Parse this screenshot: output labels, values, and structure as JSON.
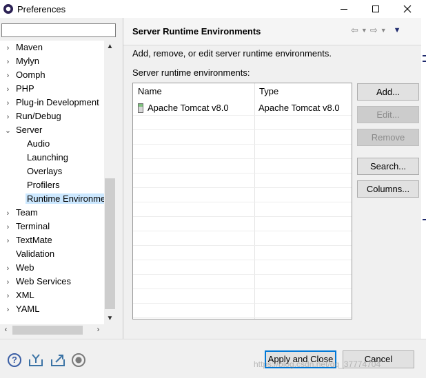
{
  "window": {
    "title": "Preferences"
  },
  "left": {
    "filter_value": "",
    "tree": [
      {
        "label": "Maven",
        "level": 0,
        "expandable": true
      },
      {
        "label": "Mylyn",
        "level": 0,
        "expandable": true
      },
      {
        "label": "Oomph",
        "level": 0,
        "expandable": true
      },
      {
        "label": "PHP",
        "level": 0,
        "expandable": true
      },
      {
        "label": "Plug-in Development",
        "level": 0,
        "expandable": true
      },
      {
        "label": "Run/Debug",
        "level": 0,
        "expandable": true
      },
      {
        "label": "Server",
        "level": 0,
        "expandable": true,
        "expanded": true
      },
      {
        "label": "Audio",
        "level": 1
      },
      {
        "label": "Launching",
        "level": 1
      },
      {
        "label": "Overlays",
        "level": 1
      },
      {
        "label": "Profilers",
        "level": 1
      },
      {
        "label": "Runtime Environme",
        "level": 1,
        "selected": true
      },
      {
        "label": "Team",
        "level": 0,
        "expandable": true
      },
      {
        "label": "Terminal",
        "level": 0,
        "expandable": true
      },
      {
        "label": "TextMate",
        "level": 0,
        "expandable": true
      },
      {
        "label": "Validation",
        "level": 0
      },
      {
        "label": "Web",
        "level": 0,
        "expandable": true
      },
      {
        "label": "Web Services",
        "level": 0,
        "expandable": true
      },
      {
        "label": "XML",
        "level": 0,
        "expandable": true
      },
      {
        "label": "YAML",
        "level": 0,
        "expandable": true
      }
    ]
  },
  "main": {
    "title": "Server Runtime Environments",
    "description": "Add, remove, or edit server runtime environments.",
    "list_label": "Server runtime environments:",
    "columns": [
      "Name",
      "Type"
    ],
    "rows": [
      {
        "name": "Apache Tomcat v8.0",
        "type": "Apache Tomcat v8.0"
      }
    ],
    "buttons": {
      "add": "Add...",
      "edit": "Edit...",
      "remove": "Remove",
      "search": "Search...",
      "columns": "Columns..."
    }
  },
  "footer": {
    "apply_close": "Apply and Close",
    "cancel": "Cancel",
    "watermark": "https://blog.csdn.net/qq_37774704"
  },
  "colors": {
    "selection": "#cce8ff",
    "default_button_border": "#0078d7"
  }
}
